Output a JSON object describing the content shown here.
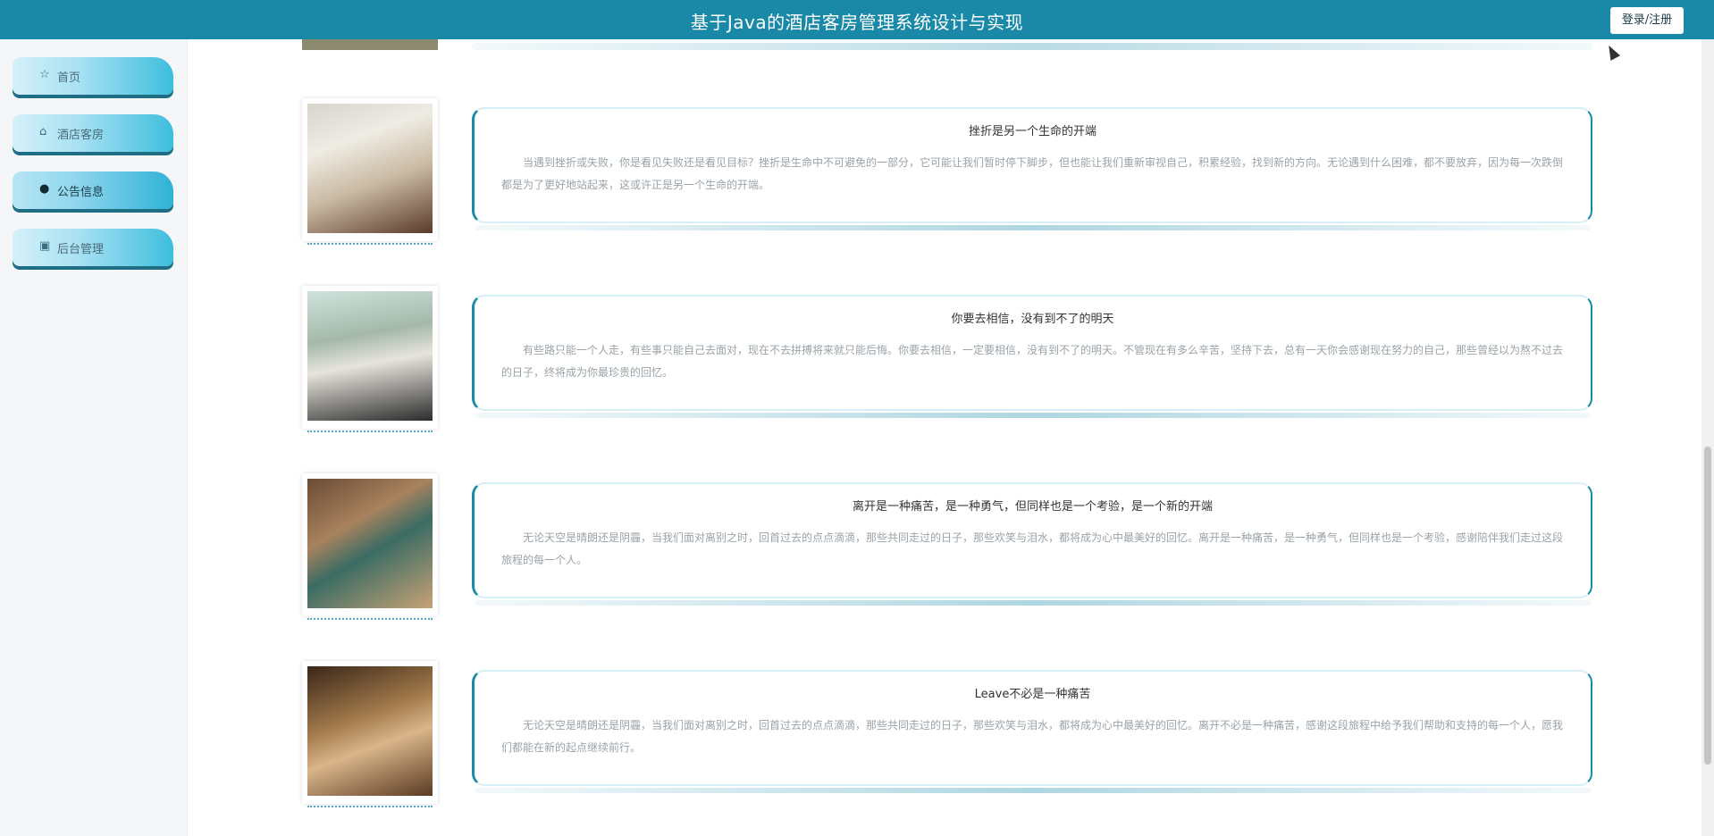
{
  "header": {
    "title": "基于Java的酒店客房管理系统设计与实现",
    "login_label": "登录/注册"
  },
  "sidebar": {
    "items": [
      {
        "label": "首页",
        "icon": "home-icon",
        "active": false
      },
      {
        "label": "酒店客房",
        "icon": "lock-icon",
        "active": false
      },
      {
        "label": "公告信息",
        "icon": "info-icon",
        "active": true
      },
      {
        "label": "后台管理",
        "icon": "archive-icon",
        "active": false
      }
    ]
  },
  "notices": [
    {
      "title": "挫折是另一个生命的开端",
      "excerpt": "当遇到挫折或失败，你是看见失败还是看见目标？挫折是生命中不可避免的一部分，它可能让我们暂时停下脚步，但也能让我们重新审视自己，积累经验，找到新的方向。无论遇到什么困难，都不要放弃，因为每一次跌倒都是为了更好地站起来，这或许正是另一个生命的开端。"
    },
    {
      "title": "你要去相信，没有到不了的明天",
      "excerpt": "有些路只能一个人走，有些事只能自己去面对，现在不去拼搏将来就只能后悔。你要去相信，一定要相信，没有到不了的明天。不管现在有多么辛苦，坚持下去，总有一天你会感谢现在努力的自己，那些曾经以为熬不过去的日子，终将成为你最珍贵的回忆。"
    },
    {
      "title": "离开是一种痛苦，是一种勇气，但同样也是一个考验，是一个新的开端",
      "excerpt": "无论天空是晴朗还是阴霾，当我们面对离别之时，回首过去的点点滴滴，那些共同走过的日子，那些欢笑与泪水，都将成为心中最美好的回忆。离开是一种痛苦，是一种勇气，但同样也是一个考验，感谢陪伴我们走过这段旅程的每一个人。"
    },
    {
      "title": "Leave不必是一种痛苦",
      "excerpt": "无论天空是晴朗还是阴霾，当我们面对离别之时，回首过去的点点滴滴，那些共同走过的日子，那些欢笑与泪水，都将成为心中最美好的回忆。离开不必是一种痛苦，感谢这段旅程中给予我们帮助和支持的每一个人，愿我们都能在新的起点继续前行。"
    }
  ]
}
